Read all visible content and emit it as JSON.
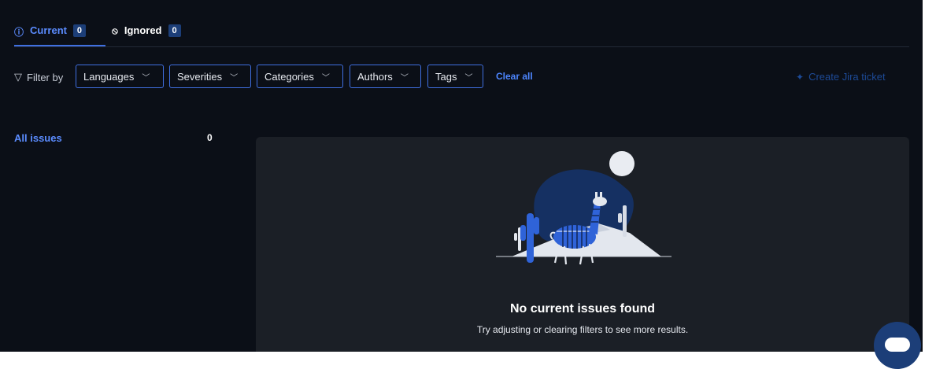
{
  "tabs": {
    "current": {
      "label": "Current",
      "count": "0"
    },
    "ignored": {
      "label": "Ignored",
      "count": "0"
    }
  },
  "filters": {
    "label": "Filter by",
    "buttons": [
      "Languages",
      "Severities",
      "Categories",
      "Authors",
      "Tags"
    ],
    "clear_all": "Clear all",
    "create_jira": "Create Jira ticket"
  },
  "sidebar": {
    "all_issues": "All issues",
    "count": "0"
  },
  "empty_state": {
    "title": "No current issues found",
    "subtitle": "Try adjusting or clearing filters to see more results."
  },
  "icons": {
    "current": "info-circle-icon",
    "ignored": "ban-icon",
    "filter": "funnel-icon",
    "jira": "jira-icon",
    "chevron": "chevron-down-icon",
    "chat": "chat-icon"
  },
  "colors": {
    "background": "#0b0f17",
    "panel": "#1b1f26",
    "accent": "#3f6fe0",
    "link": "#4d86ff",
    "badge": "#1c3e78"
  }
}
